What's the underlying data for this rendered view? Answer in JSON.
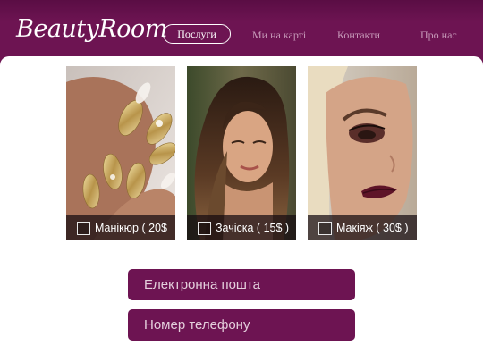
{
  "header": {
    "logo": "BeautyRoom",
    "nav": [
      {
        "label": "Послуги",
        "active": true
      },
      {
        "label": "Ми на карті",
        "active": false
      },
      {
        "label": "Контакти",
        "active": false
      },
      {
        "label": "Про нас",
        "active": false
      }
    ]
  },
  "services": [
    {
      "label": "Манікюр ( 20$",
      "photo": "manicure-nails-photo",
      "checked": false
    },
    {
      "label": "Зачіска ( 15$ )",
      "photo": "hairstyle-photo",
      "checked": false
    },
    {
      "label": "Макіяж ( 30$ )",
      "photo": "makeup-photo",
      "checked": false
    }
  ],
  "form": {
    "email_placeholder": "Електронна пошта",
    "phone_placeholder": "Номер телефону"
  },
  "colors": {
    "brand": "#6d1452",
    "panel": "#ffffff",
    "nav_inactive": "#c79ab9"
  }
}
